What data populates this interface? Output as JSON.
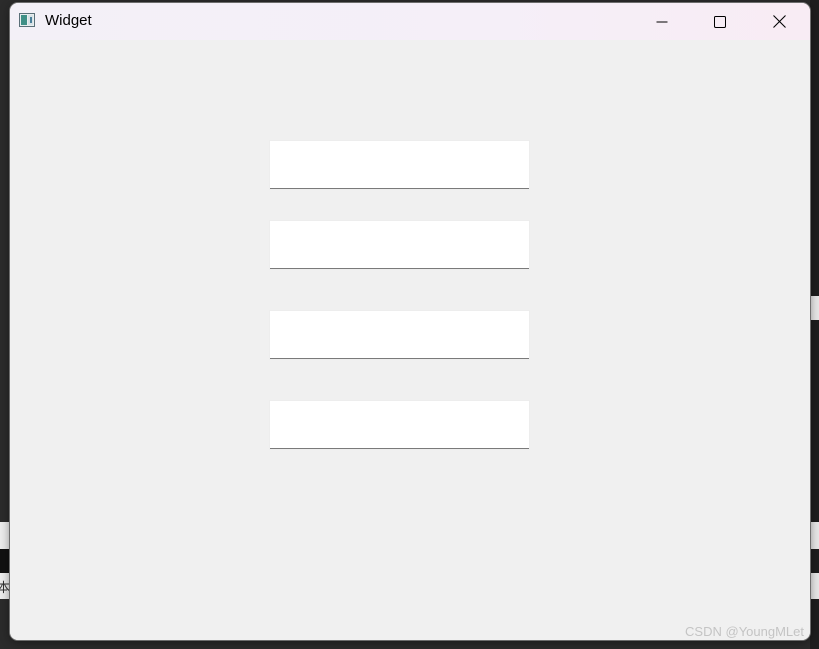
{
  "window": {
    "title": "Widget",
    "icon": "qt-window-icon"
  },
  "titlebar_buttons": {
    "minimize_icon": "minimize-icon",
    "maximize_icon": "maximize-icon",
    "close_icon": "close-icon"
  },
  "line_edits": [
    {
      "value": "",
      "placeholder": ""
    },
    {
      "value": "",
      "placeholder": ""
    },
    {
      "value": "",
      "placeholder": ""
    },
    {
      "value": "",
      "placeholder": ""
    }
  ],
  "watermark": "CSDN @YoungMLet",
  "background_fragment": "本",
  "colors": {
    "window_bg": "#f0f0f0",
    "titlebar_bg": "#f4eff7",
    "input_bg": "#ffffff",
    "input_underline": "#7a7a7a"
  }
}
